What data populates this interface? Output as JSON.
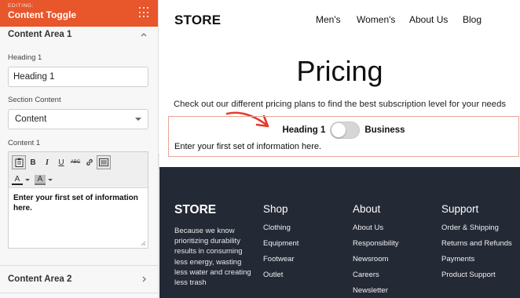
{
  "editor": {
    "editing_label": "EDITING:",
    "title": "Content Toggle",
    "area1_label": "Content Area 1",
    "heading_field_label": "Heading 1",
    "heading_value": "Heading 1",
    "section_content_label": "Section Content",
    "section_content_value": "Content",
    "content_field_label": "Content 1",
    "toolbar": {
      "bold": "B",
      "italic": "I",
      "underline": "U",
      "strike": "ABC",
      "text_color": "A",
      "bg_color": "A"
    },
    "content_value": "Enter your first set of information here.",
    "area2_label": "Content Area 2"
  },
  "site": {
    "logo": "STORE",
    "nav": [
      "Men's",
      "Women's",
      "About Us",
      "Blog"
    ],
    "title": "Pricing",
    "subtitle": "Check out our different pricing plans to find the best subscription level for your needs",
    "toggle": {
      "left_label": "Heading 1",
      "right_label": "Business",
      "content": "Enter your first set of information here."
    },
    "footer": {
      "logo": "STORE",
      "blurb": "Because we know prioritizing durability results in consuming less energy, wasting less water and creating less trash",
      "columns": [
        {
          "title": "Shop",
          "links": [
            "Clothing",
            "Equipment",
            "Footwear",
            "Outlet"
          ]
        },
        {
          "title": "About",
          "links": [
            "About Us",
            "Responsibility",
            "Newsroom",
            "Careers",
            "Newsletter"
          ]
        },
        {
          "title": "Support",
          "links": [
            "Order & Shipping",
            "Returns and Refunds",
            "Payments",
            "Product Support"
          ]
        }
      ]
    }
  },
  "colors": {
    "accent": "#e8562b",
    "footer_bg": "#242936",
    "arrow": "#e53a2c",
    "block_border": "#e8a596"
  }
}
